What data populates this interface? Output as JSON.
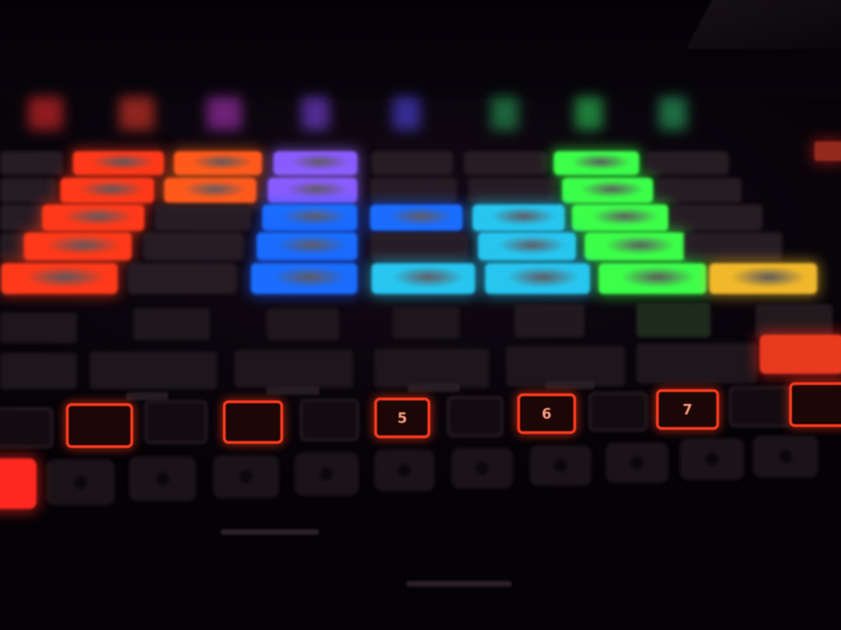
{
  "device": {
    "number_buttons": [
      {
        "label": "",
        "lit": true
      },
      {
        "label": "",
        "lit": false
      },
      {
        "label": "",
        "lit": true
      },
      {
        "label": "",
        "lit": false
      },
      {
        "label": "5",
        "lit": true
      },
      {
        "label": "",
        "lit": false
      },
      {
        "label": "6",
        "lit": true
      },
      {
        "label": "",
        "lit": false
      },
      {
        "label": "7",
        "lit": true
      },
      {
        "label": "",
        "lit": false
      },
      {
        "label": "",
        "lit": true
      }
    ]
  },
  "colors": {
    "red": "#ff3a1a",
    "orange": "#ff5a1c",
    "purple": "#8a5cff",
    "blue": "#1a6dff",
    "cyan": "#27c6f0",
    "green": "#3cff4a",
    "yellow": "#f0b82a",
    "dim_pad": "#2a1f27",
    "button_red": "#ff3a1e"
  }
}
